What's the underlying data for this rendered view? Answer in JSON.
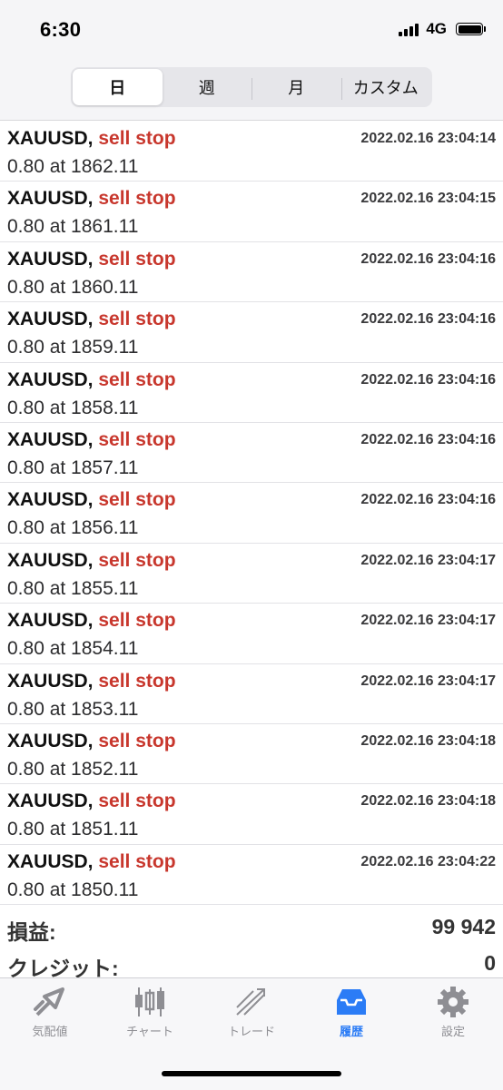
{
  "status_bar": {
    "time": "6:30",
    "network": "4G"
  },
  "segments": [
    {
      "label": "日",
      "active": true
    },
    {
      "label": "週",
      "active": false
    },
    {
      "label": "月",
      "active": false
    },
    {
      "label": "カスタム",
      "active": false
    }
  ],
  "orders": [
    {
      "symbol": "XAUUSD,",
      "type": "sell stop",
      "timestamp": "2022.02.16 23:04:14",
      "detail": "0.80 at 1862.11"
    },
    {
      "symbol": "XAUUSD,",
      "type": "sell stop",
      "timestamp": "2022.02.16 23:04:15",
      "detail": "0.80 at 1861.11"
    },
    {
      "symbol": "XAUUSD,",
      "type": "sell stop",
      "timestamp": "2022.02.16 23:04:16",
      "detail": "0.80 at 1860.11"
    },
    {
      "symbol": "XAUUSD,",
      "type": "sell stop",
      "timestamp": "2022.02.16 23:04:16",
      "detail": "0.80 at 1859.11"
    },
    {
      "symbol": "XAUUSD,",
      "type": "sell stop",
      "timestamp": "2022.02.16 23:04:16",
      "detail": "0.80 at 1858.11"
    },
    {
      "symbol": "XAUUSD,",
      "type": "sell stop",
      "timestamp": "2022.02.16 23:04:16",
      "detail": "0.80 at 1857.11"
    },
    {
      "symbol": "XAUUSD,",
      "type": "sell stop",
      "timestamp": "2022.02.16 23:04:16",
      "detail": "0.80 at 1856.11"
    },
    {
      "symbol": "XAUUSD,",
      "type": "sell stop",
      "timestamp": "2022.02.16 23:04:17",
      "detail": "0.80 at 1855.11"
    },
    {
      "symbol": "XAUUSD,",
      "type": "sell stop",
      "timestamp": "2022.02.16 23:04:17",
      "detail": "0.80 at 1854.11"
    },
    {
      "symbol": "XAUUSD,",
      "type": "sell stop",
      "timestamp": "2022.02.16 23:04:17",
      "detail": "0.80 at 1853.11"
    },
    {
      "symbol": "XAUUSD,",
      "type": "sell stop",
      "timestamp": "2022.02.16 23:04:18",
      "detail": "0.80 at 1852.11"
    },
    {
      "symbol": "XAUUSD,",
      "type": "sell stop",
      "timestamp": "2022.02.16 23:04:18",
      "detail": "0.80 at 1851.11"
    },
    {
      "symbol": "XAUUSD,",
      "type": "sell stop",
      "timestamp": "2022.02.16 23:04:22",
      "detail": "0.80 at 1850.11"
    }
  ],
  "summary": {
    "profit_label": "損益:",
    "profit_value": "99 942",
    "credit_label": "クレジット:",
    "credit_value": "0"
  },
  "tabs": [
    {
      "label": "気配値",
      "icon": "quotes-icon",
      "active": false
    },
    {
      "label": "チャート",
      "icon": "chart-icon",
      "active": false
    },
    {
      "label": "トレード",
      "icon": "trade-icon",
      "active": false
    },
    {
      "label": "履歴",
      "icon": "history-icon",
      "active": true
    },
    {
      "label": "設定",
      "icon": "settings-icon",
      "active": false
    }
  ],
  "colors": {
    "accent": "#2b7cf6",
    "sell": "#c8372d",
    "inactive_tab": "#8e8e93"
  }
}
